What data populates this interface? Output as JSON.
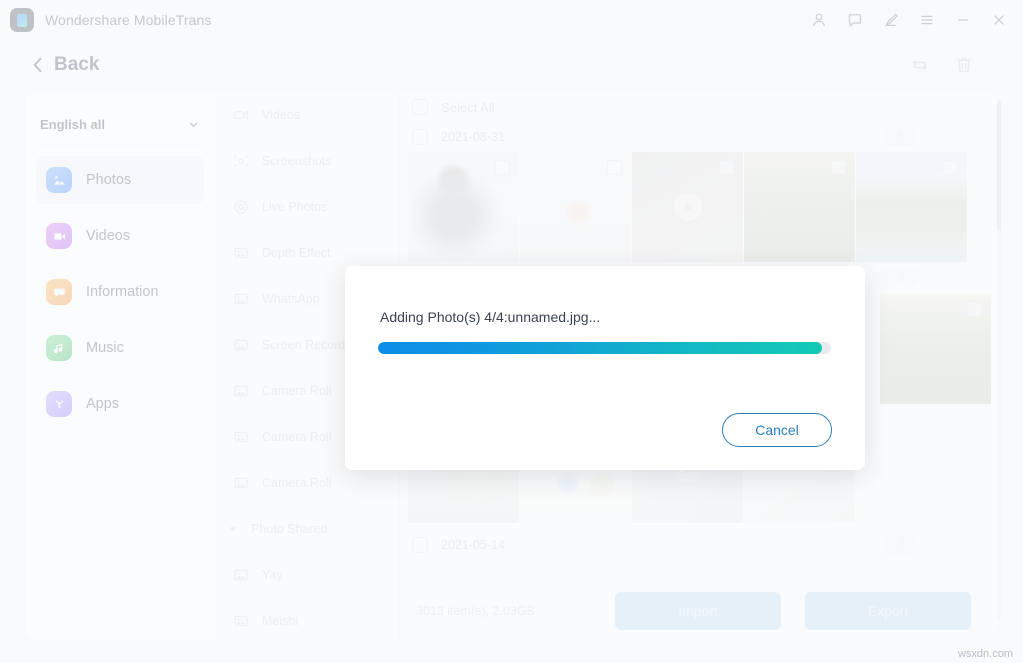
{
  "titlebar": {
    "app_title": "Wondershare MobileTrans",
    "logo_name": "mobiletrans-logo",
    "controls": [
      {
        "name": "account-icon",
        "label": "Account"
      },
      {
        "name": "feedback-icon",
        "label": "Feedback"
      },
      {
        "name": "edit-pen-icon",
        "label": "Edit"
      },
      {
        "name": "menu-icon",
        "label": "Menu"
      },
      {
        "name": "minimize-icon",
        "label": "Minimize"
      },
      {
        "name": "close-icon",
        "label": "Close"
      }
    ]
  },
  "backrow": {
    "back_label": "Back",
    "tools": [
      {
        "name": "refresh-icon",
        "label": "Refresh"
      },
      {
        "name": "trash-icon",
        "label": "Delete"
      }
    ]
  },
  "sidebar": {
    "language_selector": {
      "value": "English all",
      "caret": "chevron-down-icon"
    },
    "items": [
      {
        "label": "Photos",
        "icon": "photos-icon",
        "color": "#2f7df0",
        "active": true
      },
      {
        "label": "Videos",
        "icon": "videos-icon",
        "color": "#b44cf0",
        "active": false
      },
      {
        "label": "Information",
        "icon": "information-icon",
        "color": "#f08a1e",
        "active": false
      },
      {
        "label": "Music",
        "icon": "music-icon",
        "color": "#2bb24c",
        "active": false
      },
      {
        "label": "Apps",
        "icon": "apps-icon",
        "color": "#8a72f0",
        "active": false
      }
    ]
  },
  "categories": [
    {
      "label": "Videos",
      "icon": "video-camera-icon",
      "type": "item"
    },
    {
      "label": "Screenshots",
      "icon": "screenshot-icon",
      "type": "item"
    },
    {
      "label": "Live Photos",
      "icon": "live-photo-icon",
      "type": "item"
    },
    {
      "label": "Depth Effect",
      "icon": "album-icon",
      "type": "item"
    },
    {
      "label": "WhatsApp",
      "icon": "album-icon",
      "type": "item"
    },
    {
      "label": "Screen Recorder",
      "icon": "album-icon",
      "type": "item"
    },
    {
      "label": "Camera Roll",
      "icon": "album-icon",
      "type": "item"
    },
    {
      "label": "Camera Roll",
      "icon": "album-icon",
      "type": "item"
    },
    {
      "label": "Camera Roll",
      "icon": "album-icon",
      "type": "item"
    },
    {
      "label": "Photo Shared",
      "icon": "caret-down-icon",
      "type": "group"
    },
    {
      "label": "Yay",
      "icon": "album-icon",
      "type": "item"
    },
    {
      "label": "Meishi",
      "icon": "album-icon",
      "type": "item"
    }
  ],
  "main": {
    "select_all_label": "Select All",
    "groups": [
      {
        "date": "2021-08-31",
        "count": "5"
      },
      {
        "date": "",
        "count": "9"
      },
      {
        "date": "2021-05-14",
        "count": "3"
      }
    ],
    "thumbs_row1": [
      {
        "art": "art-person",
        "is_video": false
      },
      {
        "art": "art-flower",
        "is_video": false
      },
      {
        "art": "art-video1",
        "is_video": true
      },
      {
        "art": "art-green",
        "is_video": false
      },
      {
        "art": "art-palm",
        "is_video": false
      }
    ],
    "thumbs_row2": [
      {
        "art": "art-green2",
        "is_video": false
      }
    ],
    "thumbs_row3": [
      {
        "art": "art-totoro",
        "is_video": false
      },
      {
        "art": "art-chart",
        "is_video": false
      },
      {
        "art": "art-video2",
        "is_video": true
      },
      {
        "art": "art-cable",
        "is_video": false
      }
    ]
  },
  "bottombar": {
    "item_count": "3013 item(s), 2.03GB",
    "import_label": "Import",
    "export_label": "Export"
  },
  "modal": {
    "message": "Adding Photo(s) 4/4:unnamed.jpg...",
    "progress_percent": 98,
    "cancel_label": "Cancel",
    "progress_start_color": "#0b8ce9",
    "progress_end_color": "#12c9b4"
  },
  "watermark": "wsxdn.com"
}
